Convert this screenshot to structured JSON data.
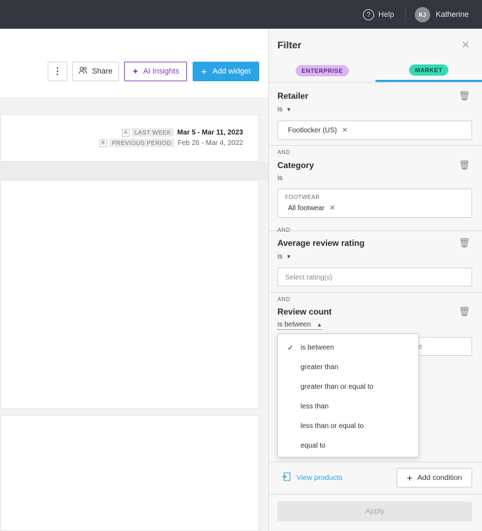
{
  "topbar": {
    "help_label": "Help",
    "user_initials": "KJ",
    "user_name": "Katherine"
  },
  "toolbar": {
    "more_glyph": "⋮",
    "share_label": "Share",
    "ai_insights_label": "AI Insights",
    "add_widget_label": "Add widget"
  },
  "dates": {
    "a": {
      "badge": "A",
      "label": "LAST WEEK",
      "value": "Mar 5 - Mar 11, 2023"
    },
    "b": {
      "badge": "B",
      "label": "PREVIOUS PERIOD",
      "value": "Feb 26 - Mar 4, 2022"
    }
  },
  "filter": {
    "title": "Filter",
    "tabs": [
      {
        "label": "ENTERPRISE",
        "active": false
      },
      {
        "label": "MARKET",
        "active": true
      }
    ],
    "conditions": [
      {
        "title": "Retailer",
        "operator": "is",
        "chips": [
          "Footlocker (US)"
        ]
      },
      {
        "and": "AND",
        "title": "Category",
        "operator": "is",
        "group": "FOOTWEAR",
        "chips": [
          "All footwear"
        ]
      },
      {
        "and": "AND",
        "title": "Average review rating",
        "operator": "is",
        "placeholder": "Select rating(s)"
      },
      {
        "and": "AND",
        "title": "Review count",
        "operator": "is between",
        "partial_text": "e"
      }
    ],
    "view_products_label": "View products",
    "add_condition_label": "Add condition",
    "apply_label": "Apply"
  },
  "operator_dropdown": {
    "selected": "is between",
    "options": [
      "is between",
      "greater than",
      "greater than or equal to",
      "less than",
      "less than or equal to",
      "equal to"
    ]
  },
  "colors": {
    "accent": "#2aa4e6",
    "ai_purple": "#8c3cc2",
    "enterprise_pill": "#dcb6f3",
    "market_pill": "#36d9b3",
    "topbar": "#33363d"
  }
}
